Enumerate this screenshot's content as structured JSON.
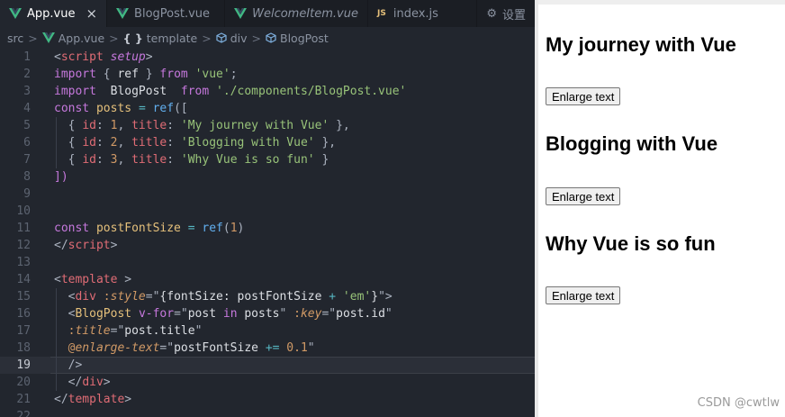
{
  "tabs": [
    {
      "label": "App.vue",
      "icon": "vue-icon",
      "active": true,
      "close": "×"
    },
    {
      "label": "BlogPost.vue",
      "icon": "vue-icon",
      "active": false
    },
    {
      "label": "WelcomeItem.vue",
      "icon": "vue-icon",
      "active": false,
      "italic": true
    },
    {
      "label": "index.js",
      "icon": "js-icon",
      "active": false
    },
    {
      "label": "设置",
      "icon": "settings-icon",
      "active": false
    }
  ],
  "js_badge": "JS",
  "breadcrumb": {
    "items": [
      "src",
      "App.vue",
      "template",
      "div",
      "BlogPost"
    ],
    "brace": "{ }",
    "separator": ">"
  },
  "code": {
    "current_line": 19,
    "lines": [
      {
        "n": "1",
        "tokens": [
          [
            "t-punc",
            "<"
          ],
          [
            "t-tag",
            "script"
          ],
          [
            "t-plain",
            " "
          ],
          [
            "t-ital",
            "setup"
          ],
          [
            "t-punc",
            ">"
          ]
        ]
      },
      {
        "n": "2",
        "tokens": [
          [
            "t-kw",
            "import"
          ],
          [
            "t-punc",
            " { "
          ],
          [
            "t-plain",
            "ref"
          ],
          [
            "t-punc",
            " } "
          ],
          [
            "t-kw",
            "from"
          ],
          [
            "t-plain",
            " "
          ],
          [
            "t-str",
            "'vue'"
          ],
          [
            "t-punc",
            ";"
          ]
        ]
      },
      {
        "n": "3",
        "tokens": [
          [
            "t-kw",
            "import"
          ],
          [
            "t-plain",
            "  BlogPost  "
          ],
          [
            "t-kw",
            "from"
          ],
          [
            "t-plain",
            " "
          ],
          [
            "t-str",
            "'./components/BlogPost.vue'"
          ]
        ]
      },
      {
        "n": "4",
        "tokens": [
          [
            "t-kw",
            "const"
          ],
          [
            "t-plain",
            " "
          ],
          [
            "t-var",
            "posts"
          ],
          [
            "t-plain",
            " "
          ],
          [
            "t-cyan",
            "="
          ],
          [
            "t-plain",
            " "
          ],
          [
            "t-fn",
            "ref"
          ],
          [
            "t-punc",
            "(["
          ]
        ]
      },
      {
        "n": "5",
        "tokens": [
          [
            "t-plain",
            "  "
          ],
          [
            "t-punc",
            "{ "
          ],
          [
            "t-prop",
            "id"
          ],
          [
            "t-punc",
            ": "
          ],
          [
            "t-num",
            "1"
          ],
          [
            "t-punc",
            ", "
          ],
          [
            "t-prop",
            "title"
          ],
          [
            "t-punc",
            ": "
          ],
          [
            "t-str",
            "'My journey with Vue'"
          ],
          [
            "t-punc",
            " },"
          ]
        ]
      },
      {
        "n": "6",
        "tokens": [
          [
            "t-plain",
            "  "
          ],
          [
            "t-punc",
            "{ "
          ],
          [
            "t-prop",
            "id"
          ],
          [
            "t-punc",
            ": "
          ],
          [
            "t-num",
            "2"
          ],
          [
            "t-punc",
            ", "
          ],
          [
            "t-prop",
            "title"
          ],
          [
            "t-punc",
            ": "
          ],
          [
            "t-str",
            "'Blogging with Vue'"
          ],
          [
            "t-punc",
            " },"
          ]
        ]
      },
      {
        "n": "7",
        "tokens": [
          [
            "t-plain",
            "  "
          ],
          [
            "t-punc",
            "{ "
          ],
          [
            "t-prop",
            "id"
          ],
          [
            "t-punc",
            ": "
          ],
          [
            "t-num",
            "3"
          ],
          [
            "t-punc",
            ", "
          ],
          [
            "t-prop",
            "title"
          ],
          [
            "t-punc",
            ": "
          ],
          [
            "t-str",
            "'Why Vue is so fun'"
          ],
          [
            "t-punc",
            " }"
          ]
        ]
      },
      {
        "n": "8",
        "tokens": [
          [
            "t-kw",
            "])"
          ]
        ]
      },
      {
        "n": "9",
        "tokens": []
      },
      {
        "n": "10",
        "tokens": []
      },
      {
        "n": "11",
        "tokens": [
          [
            "t-kw",
            "const"
          ],
          [
            "t-plain",
            " "
          ],
          [
            "t-var",
            "postFontSize"
          ],
          [
            "t-plain",
            " "
          ],
          [
            "t-cyan",
            "="
          ],
          [
            "t-plain",
            " "
          ],
          [
            "t-fn",
            "ref"
          ],
          [
            "t-punc",
            "("
          ],
          [
            "t-num",
            "1"
          ],
          [
            "t-punc",
            ")"
          ]
        ]
      },
      {
        "n": "12",
        "tokens": [
          [
            "t-punc",
            "</"
          ],
          [
            "t-tag",
            "script"
          ],
          [
            "t-punc",
            ">"
          ]
        ]
      },
      {
        "n": "13",
        "tokens": []
      },
      {
        "n": "14",
        "tokens": [
          [
            "t-punc",
            "<"
          ],
          [
            "t-tag",
            "template"
          ],
          [
            "t-punc",
            " >"
          ]
        ]
      },
      {
        "n": "15",
        "tokens": [
          [
            "t-plain",
            "  "
          ],
          [
            "t-punc",
            "<"
          ],
          [
            "t-tag",
            "div"
          ],
          [
            "t-plain",
            " "
          ],
          [
            "t-attr",
            ":"
          ],
          [
            "t-attri",
            "style"
          ],
          [
            "t-punc",
            "=\""
          ],
          [
            "t-plain",
            "{fontSize: postFontSize "
          ],
          [
            "t-cyan",
            "+"
          ],
          [
            "t-plain",
            " "
          ],
          [
            "t-str",
            "'em'"
          ],
          [
            "t-plain",
            "}"
          ],
          [
            "t-punc",
            "\">"
          ]
        ]
      },
      {
        "n": "16",
        "tokens": [
          [
            "t-plain",
            "  "
          ],
          [
            "t-punc",
            "<"
          ],
          [
            "t-comp",
            "BlogPost"
          ],
          [
            "t-plain",
            " "
          ],
          [
            "t-kw",
            "v-for"
          ],
          [
            "t-punc",
            "=\""
          ],
          [
            "t-plain",
            "post "
          ],
          [
            "t-kw",
            "in"
          ],
          [
            "t-plain",
            " posts"
          ],
          [
            "t-punc",
            "\""
          ],
          [
            "t-plain",
            " "
          ],
          [
            "t-attr",
            ":"
          ],
          [
            "t-attri",
            "key"
          ],
          [
            "t-punc",
            "=\""
          ],
          [
            "t-plain",
            "post.id"
          ],
          [
            "t-punc",
            "\""
          ]
        ]
      },
      {
        "n": "17",
        "tokens": [
          [
            "t-plain",
            "  "
          ],
          [
            "t-attr",
            ":"
          ],
          [
            "t-attri",
            "title"
          ],
          [
            "t-punc",
            "=\""
          ],
          [
            "t-plain",
            "post.title"
          ],
          [
            "t-punc",
            "\""
          ]
        ]
      },
      {
        "n": "18",
        "tokens": [
          [
            "t-plain",
            "  "
          ],
          [
            "t-attr",
            "@"
          ],
          [
            "t-attri",
            "enlarge-text"
          ],
          [
            "t-punc",
            "=\""
          ],
          [
            "t-plain",
            "postFontSize "
          ],
          [
            "t-cyan",
            "+="
          ],
          [
            "t-plain",
            " "
          ],
          [
            "t-num",
            "0.1"
          ],
          [
            "t-punc",
            "\""
          ]
        ]
      },
      {
        "n": "19",
        "tokens": [
          [
            "t-plain",
            "  "
          ],
          [
            "t-punc",
            "/>"
          ]
        ]
      },
      {
        "n": "20",
        "tokens": [
          [
            "t-plain",
            "  "
          ],
          [
            "t-punc",
            "</"
          ],
          [
            "t-tag",
            "div"
          ],
          [
            "t-punc",
            ">"
          ]
        ]
      },
      {
        "n": "21",
        "tokens": [
          [
            "t-punc",
            "</"
          ],
          [
            "t-tag",
            "template"
          ],
          [
            "t-punc",
            ">"
          ]
        ]
      },
      {
        "n": "22",
        "tokens": []
      }
    ]
  },
  "preview": {
    "posts": [
      {
        "title": "My journey with Vue",
        "button": "Enlarge text"
      },
      {
        "title": "Blogging with Vue",
        "button": "Enlarge text"
      },
      {
        "title": "Why Vue is so fun",
        "button": "Enlarge text"
      }
    ]
  },
  "watermark": "CSDN @cwtlw",
  "colors": {
    "editor_bg": "#22262e",
    "vue_green": "#41b883",
    "vue_dark": "#35495e"
  }
}
